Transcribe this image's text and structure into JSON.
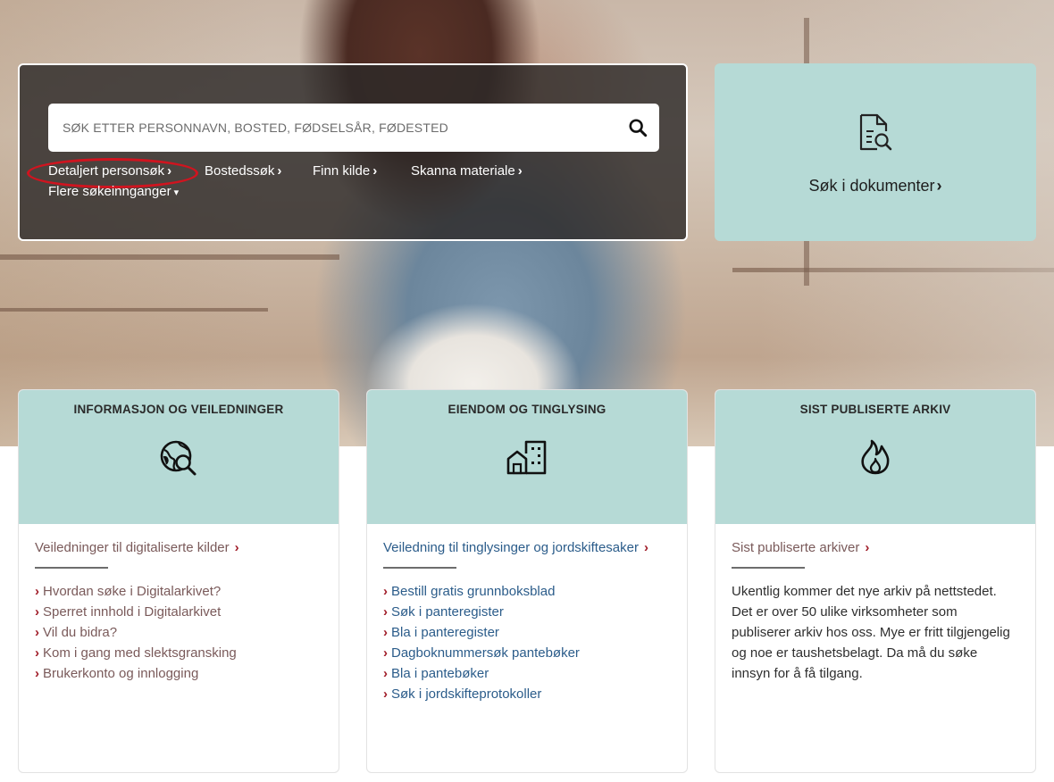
{
  "search": {
    "placeholder": "SØK ETTER PERSONNAVN, BOSTED, FØDSELSÅR, FØDESTED",
    "quick_links": [
      {
        "label": "Detaljert personsøk",
        "chevron": "›"
      },
      {
        "label": "Bostedssøk",
        "chevron": "›"
      },
      {
        "label": "Finn kilde",
        "chevron": "›"
      },
      {
        "label": "Skanna materiale",
        "chevron": "›"
      }
    ],
    "more_label": "Flere søkeinnganger",
    "more_caret": "▾"
  },
  "doc_tile": {
    "label": "Søk i dokumenter",
    "chevron": "›",
    "icon": "document-search-icon"
  },
  "cards": [
    {
      "title": "INFORMASJON OG VEILEDNINGER",
      "icon": "globe-search-icon",
      "link": "Veiledninger til digitaliserte kilder",
      "items": [
        "Hvordan søke i Digitalarkivet?",
        "Sperret innhold i Digitalarkivet",
        "Vil du bidra?",
        "Kom i gang med slektsgransking",
        "Brukerkonto og innlogging"
      ]
    },
    {
      "title": "EIENDOM OG TINGLYSING",
      "icon": "buildings-icon",
      "link": "Veiledning til tinglysinger og jordskiftesaker",
      "items": [
        "Bestill gratis grunnboksblad",
        "Søk i panteregister",
        "Bla i panteregister",
        "Dagboknummersøk pantebøker",
        "Bla i pantebøker",
        "Søk i jordskifteprotokoller"
      ]
    },
    {
      "title": "SIST PUBLISERTE ARKIV",
      "icon": "flame-icon",
      "link": "Sist publiserte arkiver",
      "text": "Ukentlig kommer det nye arkiv på nettstedet. Det er over 50 ulike virksomheter som publiserer arkiv hos oss. Mye er fritt tilgjengelig og noe er taushetsbelagt. Da må du søke innsyn for å få tilgang."
    }
  ],
  "chevron": "›",
  "colors": {
    "accent": "#a01c28",
    "tile": "#b6dad6",
    "highlight": "#d0141f"
  }
}
